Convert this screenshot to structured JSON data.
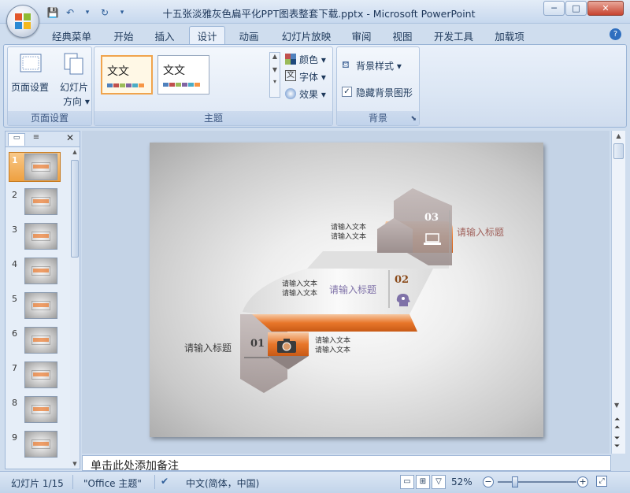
{
  "window": {
    "title": "十五张淡雅灰色扁平化PPT图表整套下载.pptx - Microsoft PowerPoint",
    "minimize": "─",
    "maximize": "□",
    "close": "✕"
  },
  "qat": {
    "save": "💾",
    "undo": "↶",
    "redo": "↻"
  },
  "tabs": [
    {
      "label": "经典菜单"
    },
    {
      "label": "开始"
    },
    {
      "label": "插入"
    },
    {
      "label": "设计"
    },
    {
      "label": "动画"
    },
    {
      "label": "幻灯片放映"
    },
    {
      "label": "审阅"
    },
    {
      "label": "视图"
    },
    {
      "label": "开发工具"
    },
    {
      "label": "加载项"
    }
  ],
  "active_tab": "设计",
  "ribbon": {
    "page_setup": {
      "group_label": "页面设置",
      "page_setup_label": "页面设置",
      "orientation_label_1": "幻灯片",
      "orientation_label_2": "方向 ▾"
    },
    "themes": {
      "group_label": "主题",
      "thumb1_text": "文文",
      "thumb2_text": "文文",
      "colors_label": "颜色 ▾",
      "fonts_label": "字体 ▾",
      "effects_label": "效果 ▾"
    },
    "background": {
      "group_label": "背景",
      "styles_label": "背景样式 ▾",
      "hide_bg_label": "隐藏背景图形",
      "hide_bg_checked": true
    }
  },
  "slides_pane": {
    "slide_numbers": [
      "1",
      "2",
      "3",
      "4",
      "5",
      "6",
      "7",
      "8",
      "9"
    ],
    "selected": 1
  },
  "slide": {
    "num1": "01",
    "num2": "02",
    "num3": "03",
    "title1": "请输入标题",
    "title2": "请输入标题",
    "title3": "请输入标题",
    "text1a": "请输入文本",
    "text1b": "请输入文本",
    "text2a": "请输入文本",
    "text2b": "请输入文本",
    "text3a": "请输入文本",
    "text3b": "请输入文本",
    "accent_orange": "#e8762a",
    "gray_shape": "#a79a99",
    "title3_color": "#a0625c",
    "title2_color": "#7f72a8"
  },
  "notes": {
    "placeholder": "单击此处添加备注"
  },
  "status": {
    "slide_info": "幻灯片 1/15",
    "theme": "\"Office 主题\"",
    "language": "中文(简体，中国)",
    "zoom": "52%"
  }
}
